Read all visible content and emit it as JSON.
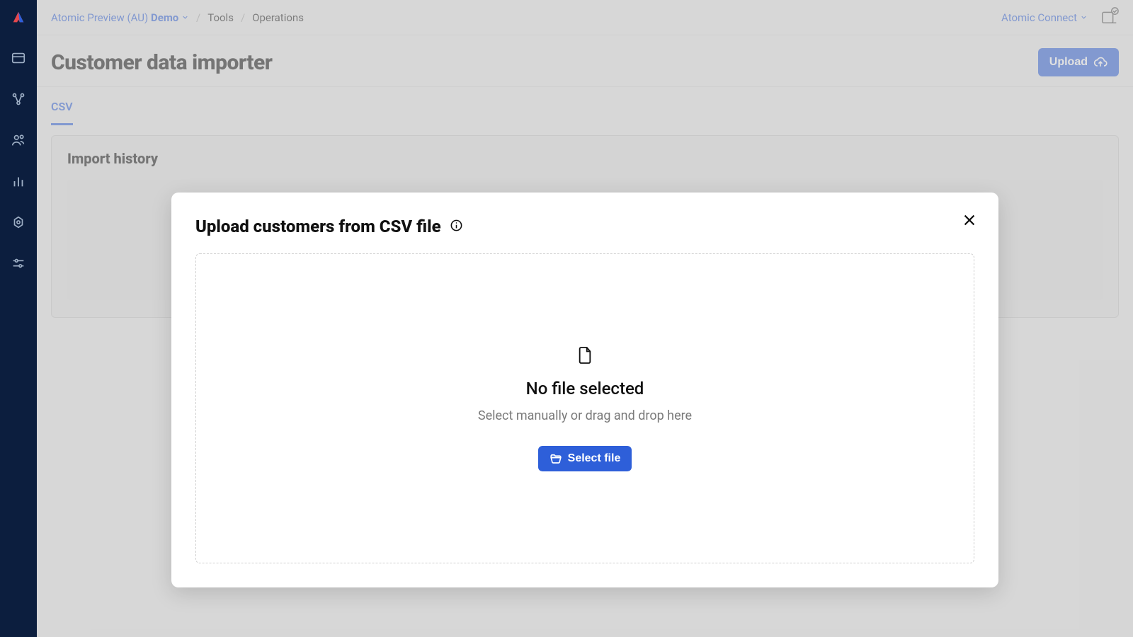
{
  "breadcrumb": {
    "org_prefix": "Atomic Preview (AU)",
    "org_suffix": "Demo",
    "items": [
      "Tools",
      "Operations"
    ]
  },
  "topbar": {
    "connect_label": "Atomic Connect"
  },
  "page": {
    "title": "Customer data importer",
    "upload_button": "Upload"
  },
  "tabs": {
    "csv": "CSV"
  },
  "importHistory": {
    "title": "Import history"
  },
  "modal": {
    "title": "Upload customers from CSV file",
    "dropzone": {
      "title": "No file selected",
      "subtitle": "Select manually or drag and drop here",
      "select_button": "Select file"
    }
  }
}
